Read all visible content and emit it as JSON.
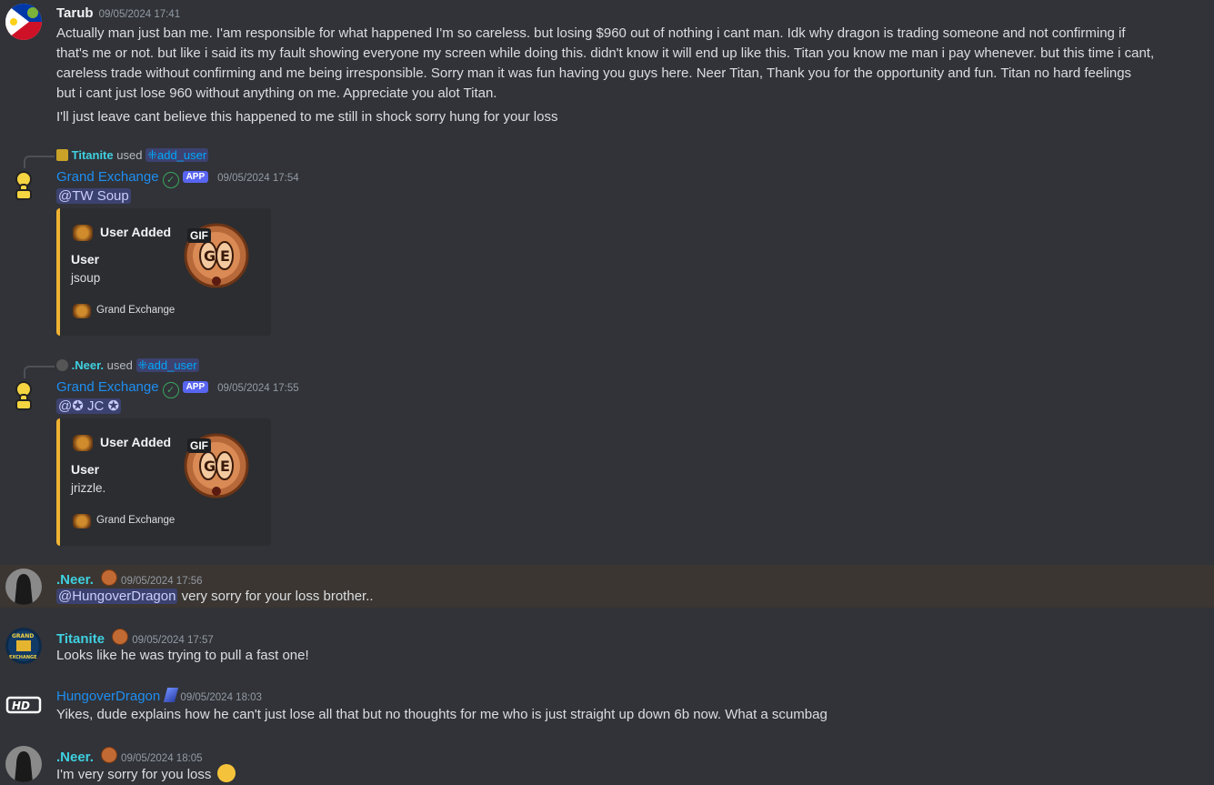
{
  "messages": {
    "tarub": {
      "author": "Tarub",
      "timestamp": "09/05/2024 17:41",
      "lines": [
        "Actually man just ban me. I'am responsible for what happened I'm so careless. but losing $960 out of nothing i cant man. Idk why dragon is trading someone and not confirming if",
        "that's me or not. but like i said its my fault showing everyone my screen while doing this. didn't know it will end up like this. Titan you know me man i pay whenever. but this time i cant,",
        "careless trade without confirming and me being irresponsible. Sorry man it was fun having you guys here. Neer Titan, Thank you for the opportunity and fun. Titan no hard feelings",
        "but i cant just lose 960 without anything on me. Appreciate you alot Titan."
      ],
      "line2": "I'll just leave cant believe this happened to me still in shock sorry hung for your loss"
    },
    "ge1": {
      "reply_user": "Titanite",
      "reply_used": "used",
      "reply_cmd": "add_user",
      "author": "Grand Exchange",
      "badge": "APP",
      "timestamp": "09/05/2024 17:54",
      "mention": "@TW Soup",
      "embed": {
        "title": "User Added",
        "field_name": "User",
        "field_value": "jsoup",
        "footer": "Grand Exchange",
        "gif_label": "GIF"
      }
    },
    "ge2": {
      "reply_user": ".Neer.",
      "reply_used": "used",
      "reply_cmd": "add_user",
      "author": "Grand Exchange",
      "badge": "APP",
      "timestamp": "09/05/2024 17:55",
      "mention": "@✪ JC ✪",
      "embed": {
        "title": "User Added",
        "field_name": "User",
        "field_value": "jrizzle.",
        "footer": "Grand Exchange",
        "gif_label": "GIF"
      }
    },
    "neer1": {
      "author": ".Neer.",
      "timestamp": "09/05/2024 17:56",
      "mention": "@HungoverDragon",
      "text": " very sorry for your loss brother.."
    },
    "titanite": {
      "author": "Titanite",
      "timestamp": "09/05/2024 17:57",
      "text": "Looks like he was trying to pull a fast one!"
    },
    "hungover": {
      "author": "HungoverDragon",
      "timestamp": "09/05/2024 18:03",
      "text": "Yikes, dude explains how he can't just lose all that but no thoughts for me who is just straight up down 6b now. What a scumbag"
    },
    "neer2": {
      "author": ".Neer.",
      "timestamp": "09/05/2024 18:05",
      "text": "I'm very sorry for you loss"
    }
  },
  "colors": {
    "background": "#313338",
    "embed_accent": "#f0b232",
    "app_badge": "#5865f2",
    "teal_name": "#3fd0e0",
    "blue_name": "#1f8ef1",
    "highlight": "#3b3632"
  },
  "icons": {
    "verified": "check-circle-icon",
    "command": "slash-command-icon",
    "ge_logo": "ge-coin-logo",
    "badge": "gold-coin-badge-icon"
  }
}
